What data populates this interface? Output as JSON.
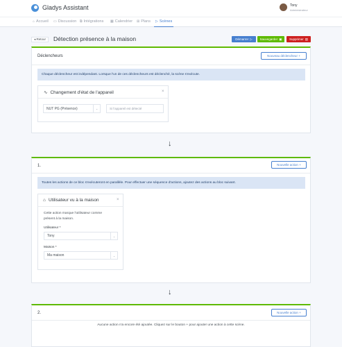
{
  "app": {
    "brand": "Gladys Assistant",
    "user_name": "Tony",
    "user_role": "Administrateur"
  },
  "nav": [
    {
      "label": "Accueil",
      "icon": "home-icon",
      "glyph": "⌂"
    },
    {
      "label": "Discussion",
      "icon": "chat-icon",
      "glyph": "▭"
    },
    {
      "label": "Intégrations",
      "icon": "integrations-icon",
      "glyph": "⧉"
    },
    {
      "label": "Calendrier",
      "icon": "calendar-icon",
      "glyph": "▦"
    },
    {
      "label": "Plans",
      "icon": "map-icon",
      "glyph": "⊞"
    },
    {
      "label": "Scènes",
      "icon": "play-icon",
      "glyph": "▷"
    }
  ],
  "page": {
    "back_label": "◂ Retour",
    "title": "Détection présence à la maison",
    "start_label": "Démarrer",
    "save_label": "Sauvegarder",
    "delete_label": "Supprimer"
  },
  "triggers": {
    "title": "Déclencheurs",
    "new_label": "Nouveau déclencheur",
    "info": "Chaque déclencheur est indépendant. Lorsque l'un de ces déclencheurs est déclenché, la scène s'exécute.",
    "card_title": "Changement d'état de l'appareil",
    "device_value": "NUT PG (Présence)",
    "condition_value": "Si l'appareil est détecté"
  },
  "block1": {
    "title": "1.",
    "new_label": "Nouvelle action",
    "info": "Toutes les actions de ce bloc s'exécuteront en parallèle. Pour effectuer une séquence d'actions, ajoutez des actions au bloc suivant.",
    "card_title": "Utilisateur vu à la maison",
    "desc_line1": "Cette action marque l'utilisateur comme",
    "desc_line2": "présent à la maison.",
    "user_label": "Utilisateur *",
    "user_value": "Tony",
    "house_label": "Maison *",
    "house_value": "Ma maison"
  },
  "block2": {
    "title": "2.",
    "new_label": "Nouvelle action",
    "empty": "Aucune action n'a encore été ajoutée. Cliquez sur le bouton + pour ajouter une action à cette scène."
  },
  "colors": {
    "primary": "#467fcf",
    "success": "#5eba00",
    "danger": "#cd201f",
    "info_bg": "#dae5f5"
  }
}
